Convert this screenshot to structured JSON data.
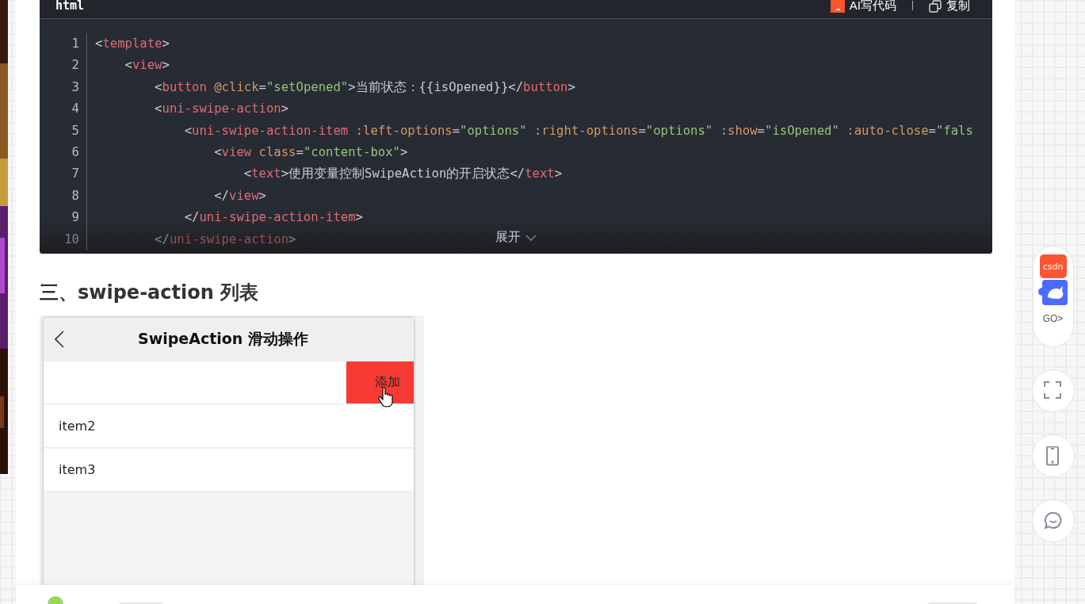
{
  "code_block": {
    "language": "html",
    "actions": [
      {
        "kind": "ai",
        "label": "AI写代码"
      },
      {
        "kind": "copy",
        "label": "复制"
      }
    ],
    "lines": [
      {
        "number": "1",
        "faded": false,
        "tokens": [
          {
            "kind": "p",
            "t": "<"
          },
          {
            "kind": "tag",
            "t": "template"
          },
          {
            "kind": "p",
            "t": ">"
          }
        ]
      },
      {
        "number": "2",
        "faded": false,
        "tokens": [
          {
            "kind": "p",
            "t": "    <"
          },
          {
            "kind": "tag",
            "t": "view"
          },
          {
            "kind": "p",
            "t": ">"
          }
        ]
      },
      {
        "number": "3",
        "faded": false,
        "tokens": [
          {
            "kind": "p",
            "t": "        <"
          },
          {
            "kind": "tag",
            "t": "button"
          },
          {
            "kind": "attr",
            "t": " @click"
          },
          {
            "kind": "p",
            "t": "="
          },
          {
            "kind": "str",
            "t": "\"setOpened\""
          },
          {
            "kind": "p",
            "t": ">当前状态：{{isOpened}}</"
          },
          {
            "kind": "tag",
            "t": "button"
          },
          {
            "kind": "p",
            "t": ">"
          }
        ]
      },
      {
        "number": "4",
        "faded": false,
        "tokens": [
          {
            "kind": "p",
            "t": "        <"
          },
          {
            "kind": "tag",
            "t": "uni-swipe-action"
          },
          {
            "kind": "p",
            "t": ">"
          }
        ]
      },
      {
        "number": "5",
        "faded": false,
        "tokens": [
          {
            "kind": "p",
            "t": "            <"
          },
          {
            "kind": "tag",
            "t": "uni-swipe-action-item"
          },
          {
            "kind": "attr",
            "t": " :left-options"
          },
          {
            "kind": "p",
            "t": "="
          },
          {
            "kind": "str",
            "t": "\"options\""
          },
          {
            "kind": "attr",
            "t": " :right-options"
          },
          {
            "kind": "p",
            "t": "="
          },
          {
            "kind": "str",
            "t": "\"options\""
          },
          {
            "kind": "attr",
            "t": " :show"
          },
          {
            "kind": "p",
            "t": "="
          },
          {
            "kind": "str",
            "t": "\"isOpened\""
          },
          {
            "kind": "attr",
            "t": " :auto-close"
          },
          {
            "kind": "p",
            "t": "="
          },
          {
            "kind": "str",
            "t": "\"fals"
          }
        ]
      },
      {
        "number": "6",
        "faded": false,
        "tokens": [
          {
            "kind": "p",
            "t": "                <"
          },
          {
            "kind": "tag",
            "t": "view"
          },
          {
            "kind": "attr",
            "t": " class"
          },
          {
            "kind": "p",
            "t": "="
          },
          {
            "kind": "str",
            "t": "\"content-box\""
          },
          {
            "kind": "p",
            "t": ">"
          }
        ]
      },
      {
        "number": "7",
        "faded": false,
        "tokens": [
          {
            "kind": "p",
            "t": "                    <"
          },
          {
            "kind": "tag",
            "t": "text"
          },
          {
            "kind": "p",
            "t": ">使用变量控制SwipeAction的开启状态</"
          },
          {
            "kind": "tag",
            "t": "text"
          },
          {
            "kind": "p",
            "t": ">"
          }
        ]
      },
      {
        "number": "8",
        "faded": false,
        "tokens": [
          {
            "kind": "p",
            "t": "                </"
          },
          {
            "kind": "tag",
            "t": "view"
          },
          {
            "kind": "p",
            "t": ">"
          }
        ]
      },
      {
        "number": "9",
        "faded": false,
        "tokens": [
          {
            "kind": "p",
            "t": "            </"
          },
          {
            "kind": "tag",
            "t": "uni-swipe-action-item"
          },
          {
            "kind": "p",
            "t": ">"
          }
        ]
      },
      {
        "number": "10",
        "faded": true,
        "tokens": [
          {
            "kind": "p",
            "t": "        </"
          },
          {
            "kind": "tag",
            "t": "uni-swipe-action"
          },
          {
            "kind": "p",
            "t": ">"
          }
        ]
      }
    ],
    "expand_label": "展开"
  },
  "section_heading": "三、swipe-action 列表",
  "phone_demo": {
    "title": "SwipeAction 滑动操作",
    "rows": [
      {
        "kind": "swiped",
        "action": "添加"
      },
      {
        "kind": "plain",
        "text": "item2"
      },
      {
        "kind": "plain",
        "text": "item3"
      }
    ]
  },
  "side_tools": {
    "promo_logo": "csdn",
    "promo_label": "GO>",
    "buttons": [
      {
        "kind": "fullscreen"
      },
      {
        "kind": "phone"
      },
      {
        "kind": "chat"
      }
    ]
  }
}
